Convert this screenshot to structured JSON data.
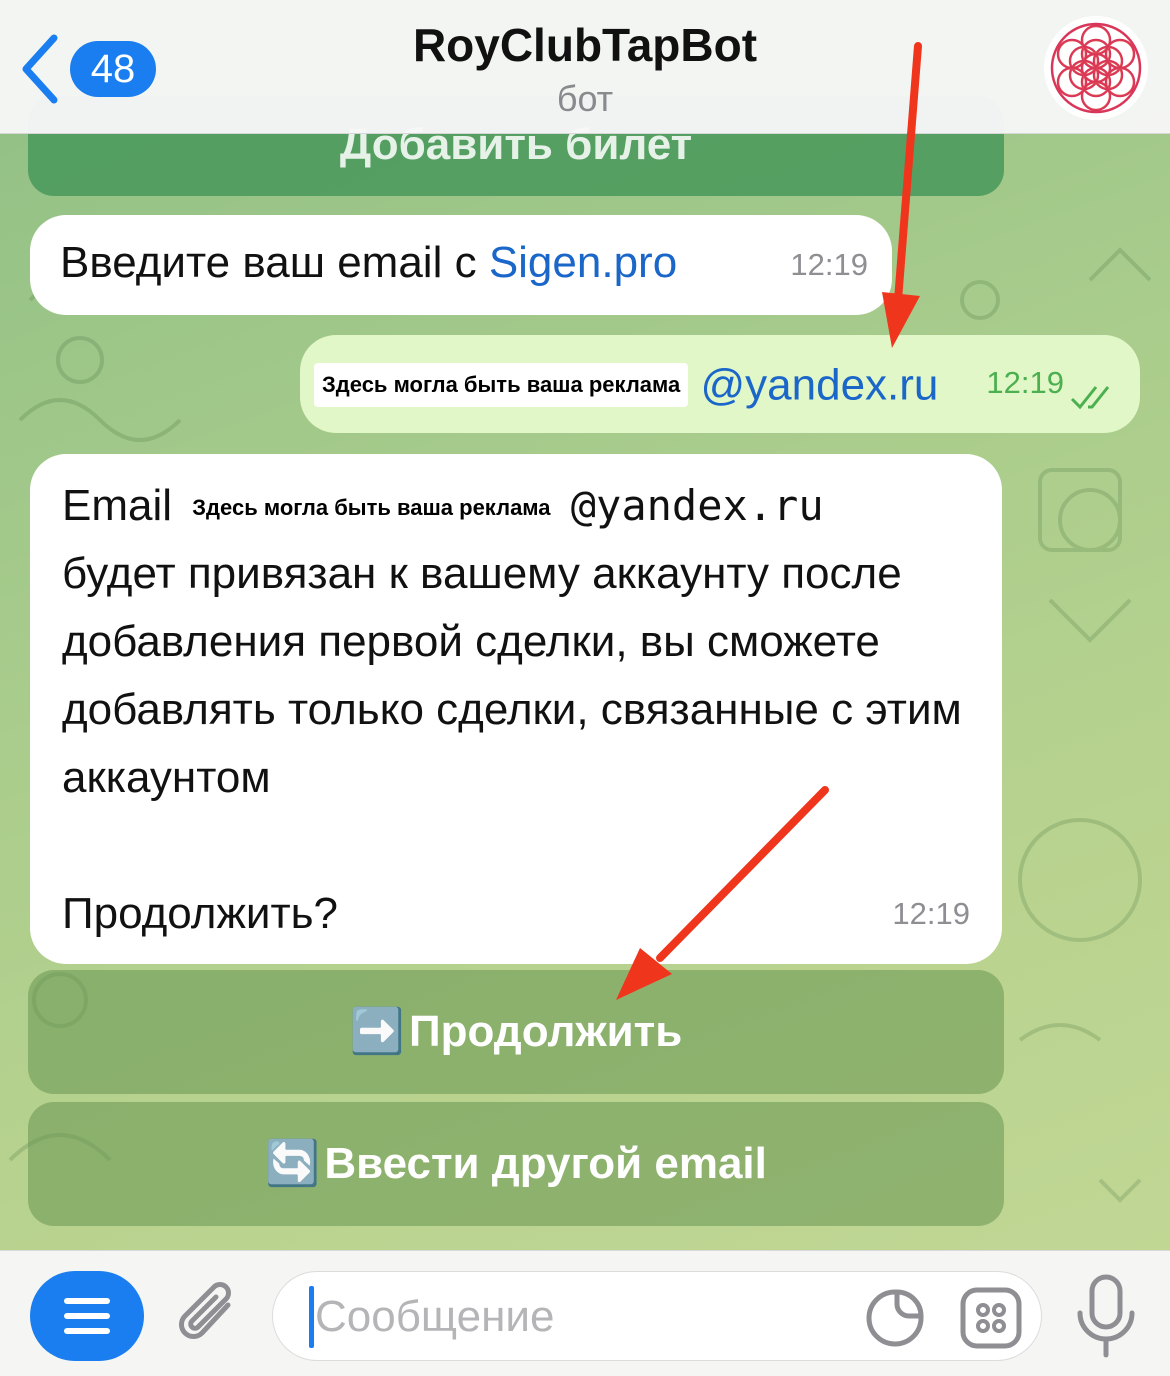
{
  "header": {
    "back_count": "48",
    "title": "RoyClubTapBot",
    "subtitle": "бот"
  },
  "chat": {
    "top_button_partial": "Добавить билет",
    "msg_in_1": {
      "text": "Введите ваш email с ",
      "link": "Sigen.pro",
      "time": "12:19"
    },
    "msg_out": {
      "ad": "Здесь могла быть ваша реклама",
      "text": "@yandex.ru",
      "time": "12:19"
    },
    "msg_in_2": {
      "prefix": "Email",
      "ad": "Здесь могла быть ваша реклама",
      "mono": "@yandex.ru",
      "body": "будет привязан к вашему аккаунту после добавления первой сделки, вы сможете добавлять только сделки, связанные с этим аккаунтом",
      "question": "Продолжить?",
      "time": "12:19"
    },
    "buttons": [
      {
        "emoji": "➡️",
        "label": "Продолжить"
      },
      {
        "emoji": "🔄",
        "label": "Ввести другой email"
      }
    ]
  },
  "input": {
    "placeholder": "Сообщение"
  },
  "colors": {
    "accent": "#1a7ef0",
    "arrow": "#f0351d",
    "out_bubble": "#e2f7c8",
    "time_out": "#4caf50"
  },
  "icons": [
    "chevron-left-icon",
    "menu-icon",
    "paperclip-icon",
    "sticker-icon",
    "emoji-grid-icon",
    "microphone-icon",
    "double-check-icon"
  ]
}
